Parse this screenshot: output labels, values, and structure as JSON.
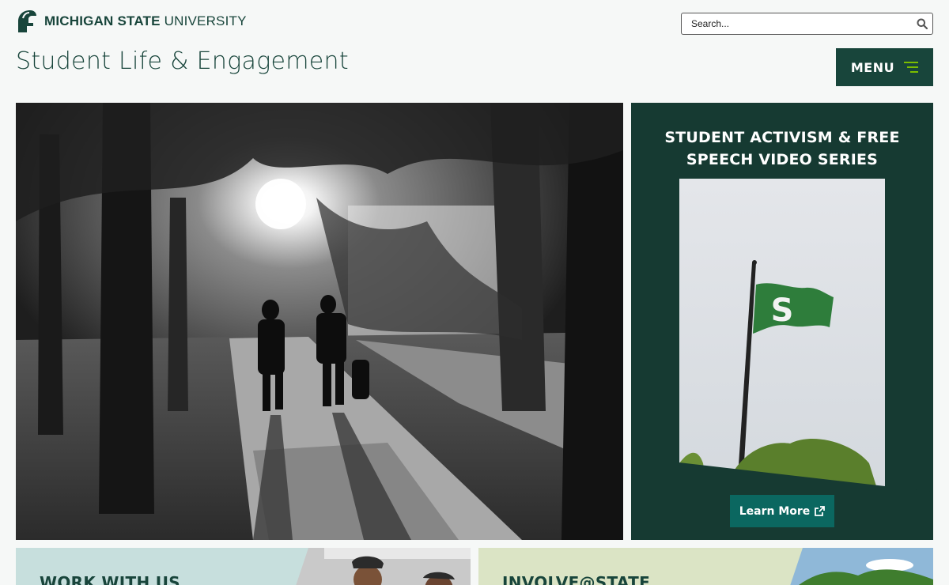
{
  "brand": {
    "university_bold": "MICHIGAN STATE",
    "university_light": "UNIVERSITY",
    "logo_icon": "spartan-helmet-icon",
    "color_primary": "#18453b",
    "color_accent": "#7bbd00",
    "color_teal": "#0b6760"
  },
  "header": {
    "site_title": "Student Life & Engagement",
    "search_placeholder": "Search...",
    "search_icon": "search-icon",
    "menu_label": "MENU",
    "menu_icon": "hamburger-icon"
  },
  "hero": {
    "image": "black-and-white photo of students walking on a tree-lined campus sidewalk"
  },
  "feature": {
    "title": "STUDENT ACTIVISM & FREE SPEECH VIDEO SERIES",
    "image": "green Spartan 'S' flag on a flagpole",
    "flag_letter": "S",
    "cta_label": "Learn More",
    "cta_icon": "external-link-icon"
  },
  "cards": [
    {
      "title": "WORK WITH US"
    },
    {
      "title": "INVOLVE@STATE"
    }
  ]
}
